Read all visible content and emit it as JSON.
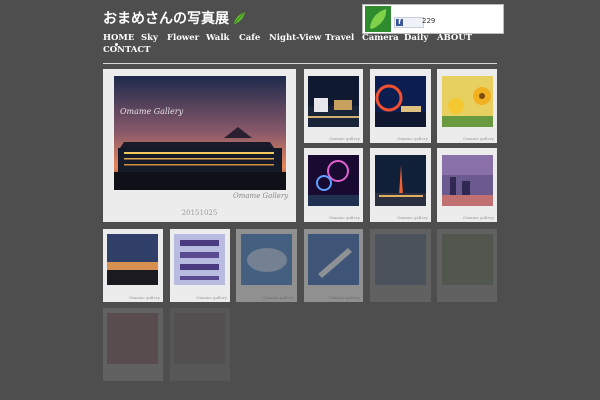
{
  "site": {
    "title": "おまめさんの写真展"
  },
  "social": {
    "like_count": "229",
    "like_icon": "facebook-like-icon"
  },
  "nav": {
    "items": [
      "HOME",
      "Sky",
      "Flower",
      "Walk",
      "Cafe",
      "Night-View",
      "Travel",
      "Camera",
      "Daily",
      "ABOUT",
      "CONTACT"
    ]
  },
  "featured": {
    "date": "20151025",
    "watermark": "Omame Gallery",
    "watermark2": "Omame Gallery"
  },
  "gallery": {
    "caption": "Omame gallery"
  },
  "colors": {
    "background": "#4e4e4e",
    "tile": "#ececec",
    "text": "#ffffff"
  }
}
